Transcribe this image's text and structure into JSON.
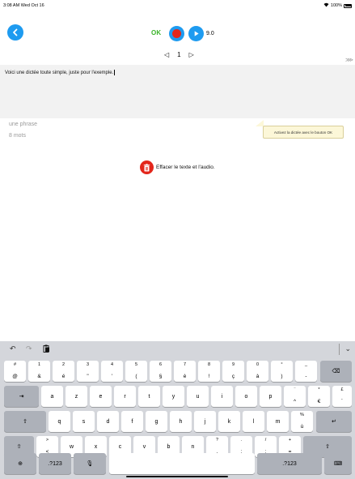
{
  "status_bar": {
    "time": "3:08 AM  Wed Oct 16",
    "battery": "100%"
  },
  "toolbar": {
    "ok_label": "OK",
    "duration": "9.0"
  },
  "pager": {
    "prev": "◁",
    "page": "1",
    "next": "▷"
  },
  "editor": {
    "text": "Voici une dictée toute simple, juste pour l'exemple."
  },
  "tooltip": {
    "text": "Activez la dictée avec le bouton OK"
  },
  "info": {
    "phrases": "une phrase",
    "words": "8 mots"
  },
  "clear": {
    "label": "Effacer le texte et l'audio."
  },
  "keyboard": {
    "row1": [
      {
        "top": "#",
        "bot": "@"
      },
      {
        "top": "1",
        "bot": "&"
      },
      {
        "top": "2",
        "bot": "é"
      },
      {
        "top": "3",
        "bot": "\""
      },
      {
        "top": "4",
        "bot": "'"
      },
      {
        "top": "5",
        "bot": "("
      },
      {
        "top": "6",
        "bot": "§"
      },
      {
        "top": "7",
        "bot": "è"
      },
      {
        "top": "8",
        "bot": "!"
      },
      {
        "top": "9",
        "bot": "ç"
      },
      {
        "top": "0",
        "bot": "à"
      },
      {
        "top": "°",
        "bot": ")"
      },
      {
        "top": "_",
        "bot": "-"
      }
    ],
    "row2": [
      "a",
      "z",
      "e",
      "r",
      "t",
      "y",
      "u",
      "i",
      "o",
      "p"
    ],
    "row2_extra": [
      {
        "top": "¨",
        "bot": "^"
      },
      {
        "top": "*",
        "bot": "€"
      },
      {
        "top": "£",
        "bot": "`"
      }
    ],
    "row3": [
      "q",
      "s",
      "d",
      "f",
      "g",
      "h",
      "j",
      "k",
      "l",
      "m"
    ],
    "row3_extra": {
      "top": "%",
      "bot": "ù"
    },
    "row4": [
      {
        "top": ">",
        "bot": "<"
      },
      {
        "top": "",
        "bot": "w"
      },
      {
        "top": "",
        "bot": "x"
      },
      {
        "top": "",
        "bot": "c"
      },
      {
        "top": "",
        "bot": "v"
      },
      {
        "top": "",
        "bot": "b"
      },
      {
        "top": "",
        "bot": "n"
      },
      {
        "top": "?",
        "bot": ","
      },
      {
        "top": ".",
        "bot": ";"
      },
      {
        "top": "/",
        "bot": ":"
      },
      {
        "top": "+",
        "bot": "="
      }
    ],
    "numbers_label": ".?123"
  }
}
